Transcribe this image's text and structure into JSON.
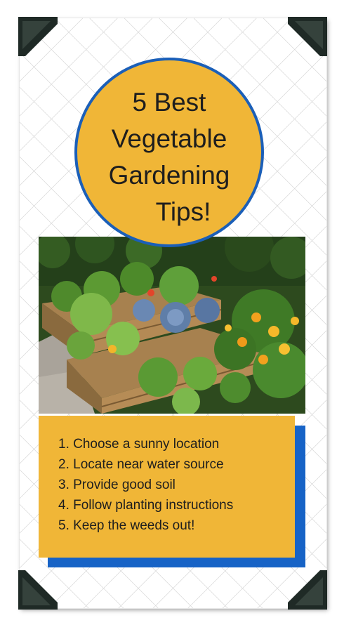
{
  "title": {
    "lines": [
      "5 Best",
      "Vegetable",
      "Gardening",
      "Tips!"
    ]
  },
  "tips": [
    "1. Choose a sunny location",
    "2. Locate near water source",
    "3. Provide good soil",
    "4. Follow planting instructions",
    "5. Keep the weeds out!"
  ],
  "colors": {
    "accent_yellow": "#f0b637",
    "accent_blue": "#1763c6",
    "corner_dark": "#1f2a26"
  },
  "photo": {
    "subject": "raised wooden garden beds with cabbages and marigolds"
  }
}
